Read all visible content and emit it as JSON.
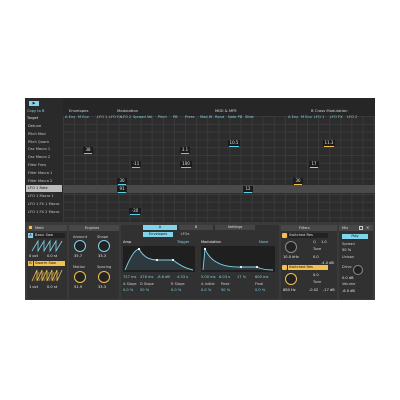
{
  "matrix": {
    "top_left_btn": "▶",
    "copy_label": "Copy to B",
    "target_header": "Target",
    "targets": [
      "Detune",
      "Pitch Mod",
      "Pitch Quant",
      "Osc Macro 1",
      "Osc Macro 2",
      "Filter Freq",
      "Filter Macro 1",
      "Filter Macro 2",
      "LFO 1 Rate",
      "LFO 1 Macro 1",
      "LFO 1 FX 1 Macro",
      "LFO 1 FX 2 Macro"
    ],
    "selected_target": "LFO 1 Rate",
    "sections": {
      "envelopes": "Envelopes",
      "modulation": "Modulation",
      "midi_mpe": "MIDI & MPE",
      "bcross": "B Cross Modulation"
    },
    "columns": [
      "A Env",
      "M Env",
      "LFO 1",
      "LFO FX",
      "LFO 2",
      "Spread",
      "Vel",
      "Pitch",
      "PB",
      "Press",
      "Mod W",
      "Rand",
      "Note PB",
      "Slide",
      "A Env",
      "M Env",
      "LFO 1",
      "LFO FX",
      "LFO 2"
    ],
    "values": {
      "v1": "38",
      "v2": "-11",
      "v3": "3.1",
      "v4": "100",
      "v5": "10.5",
      "v6": "30",
      "v7": "91",
      "v8": "12",
      "v9": "11.3",
      "v10": "17",
      "v11": "30",
      "v12": "-30"
    }
  },
  "device": {
    "meld_title": "Meld",
    "osc_a_label": "A",
    "osc_a_name": "Basic Saw",
    "osc_a_oct": "0 oct",
    "osc_a_fine": "0.0 st",
    "osc_b_label": "B",
    "osc_b_name": "Swarm Saw",
    "osc_b_oct": "1 oct",
    "osc_b_fine": "0.0 st",
    "engines": {
      "title": "Engines",
      "amount_label": "Amount",
      "amount_val": "35.7",
      "shape_label": "Shape",
      "shape_val": "33.3",
      "motion_label": "Motion",
      "motion_val": "51.9",
      "spacing_label": "Spacing",
      "spacing_val": "33.3"
    },
    "tabs": {
      "a": "A",
      "b": "B",
      "settings": "Settings"
    },
    "envelopes_btn": "Envelopes",
    "lfo_btn": "LFOs",
    "amp": {
      "label": "Amp",
      "trigger": "Trigger",
      "a_val": "727 ms",
      "d_val": "476 ms",
      "s_val": "-8.6 dB",
      "r_val": "4.33 s",
      "aslope_label": "A Slope",
      "aslope_val": "0.0 %",
      "dslope_label": "D Slope",
      "dslope_val": "50 %",
      "rslope_label": "R Slope",
      "rslope_val": "0.0 %"
    },
    "modenv": {
      "label": "Modulation",
      "mode": "None",
      "a_val": "5.00 ms",
      "d_val": "6.03 s",
      "s_val": "17 %",
      "r_val": "600 ms",
      "initial_label": "A Initial",
      "initial_val": "0.0 %",
      "peak_label": "Peak",
      "peak_val": "50 %",
      "final_label": "Final",
      "final_val": "0.0 %"
    },
    "filters": {
      "title": "Filters",
      "f1_type": "Switched Res",
      "f1_freq": "10.0 kHz",
      "f1_res_label": "Q",
      "f1_tone_label": "Tone",
      "f1_tone_val": "0.0",
      "f1_val2": "1.0",
      "f1_val3": "-4.0 dB",
      "f2_type": "Switched Res",
      "f2_freq": "880 Hz",
      "f2_val1": "0.0",
      "f2_tone_label": "Tone",
      "f2_tone_val": "-0.02",
      "f2_val3": "-17 dB"
    },
    "mix": {
      "title": "Mix",
      "mono_label": "Poly",
      "spread_label": "Spread",
      "spread_val": "50 %",
      "unison_label": "Unison",
      "unison_val": "Drive",
      "drive_val": "0.0 dB",
      "volume_label": "Volume",
      "volume_val": "-6.0 dB"
    }
  },
  "colors": {
    "accent": "#7fd3ea",
    "yellow": "#f2c14e",
    "bg": "#2b2b2b"
  }
}
